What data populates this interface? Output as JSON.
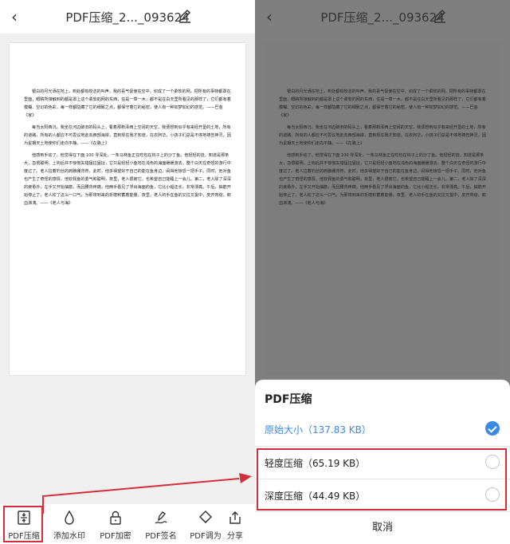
{
  "header": {
    "back_icon": "‹",
    "title": "PDF压缩_2..._093624",
    "edit_icon": "pencil-icon"
  },
  "document": {
    "paragraphs": [
      "银白的月光洒在地上，到处都有皎洁的叫声，我的喜气促使在空中，织成了一个柔软的网，把所有的事物都罩在里面，眼睛所接触到的都是罩上这个柔软的网的东西，任是一草一木，都不是在白天里所看见的那样了，它们都有着模糊、空幻的色彩，每一样都隐藏了它的细致之点，都保守着它的秘密，使人有一种如梦如幻的感觉。——巴金《家》",
      "每当太阳西沉，我坐在河边破旧的码头上，看着那新泽西上空阔的天空，我便想到似乎有来经开垦的土地，所有的道路，所有的人都应不可思议地走向西部海岸，直到现在我才知道，在衣阿华，小孩子们总是不停地祷告神灵，因为星期天土地使你们走向平静。——《在路上》",
      "他感到手动了。他觉得在下面 100 寻深处，一条马林鱼正在吃包在钩子上的沙丁鱼。他轻轻的挂，知道是那条大，急很聪明，上钩后并不惊慌失措猛拉猛扯，它只是轻轻小鱼地在浅色的海面缓缓游去，整个白天在奇怪的游行中度过了。老人拉着钓丝的肩膀绷背脊，此时，他多得望好于自己的能在鱼身边，闹得他惊恐一把手子。同时，他对鱼也产生了奇怪的感情，他钦佩鱼的勇气和聪明，夜里，老人很被它，也希望自己能睡上一会儿。第二，老人除了深深的疲惫外，左手又开始抽筋，而且腰背疼痛，他两手看见了浮出海面的鱼，它比小船还长，非常漂亮。午后，抽筋开始停止了，老人松了这么一口气，为那将到来的折磨积蓄着能量。夜里，老人的手在鱼的又拉又拔中，皮开肉绽，鲜血淋漓。——《老人与海》"
    ]
  },
  "toolbar": {
    "items": [
      {
        "label": "PDF压缩",
        "icon": "compress-icon"
      },
      {
        "label": "添加水印",
        "icon": "watermark-drop-icon"
      },
      {
        "label": "PDF加密",
        "icon": "lock-icon"
      },
      {
        "label": "PDF签名",
        "icon": "signature-pen-icon"
      },
      {
        "label": "PDF调为",
        "icon": "adjust-icon"
      },
      {
        "label": "分享",
        "icon": "share-icon"
      }
    ]
  },
  "sheet": {
    "title": "PDF压缩",
    "options": [
      {
        "label": "原始大小（137.83 KB）",
        "selected": true,
        "color": "#3b8ae6"
      },
      {
        "label": "轻度压缩（65.19 KB）",
        "selected": false,
        "color": "#222222"
      },
      {
        "label": "深度压缩（44.49 KB）",
        "selected": false,
        "color": "#222222"
      }
    ],
    "cancel_label": "取消"
  },
  "colors": {
    "accent": "#3b8ae6",
    "highlight_red": "#d32f3a",
    "overlay": "#7f7f7f"
  }
}
